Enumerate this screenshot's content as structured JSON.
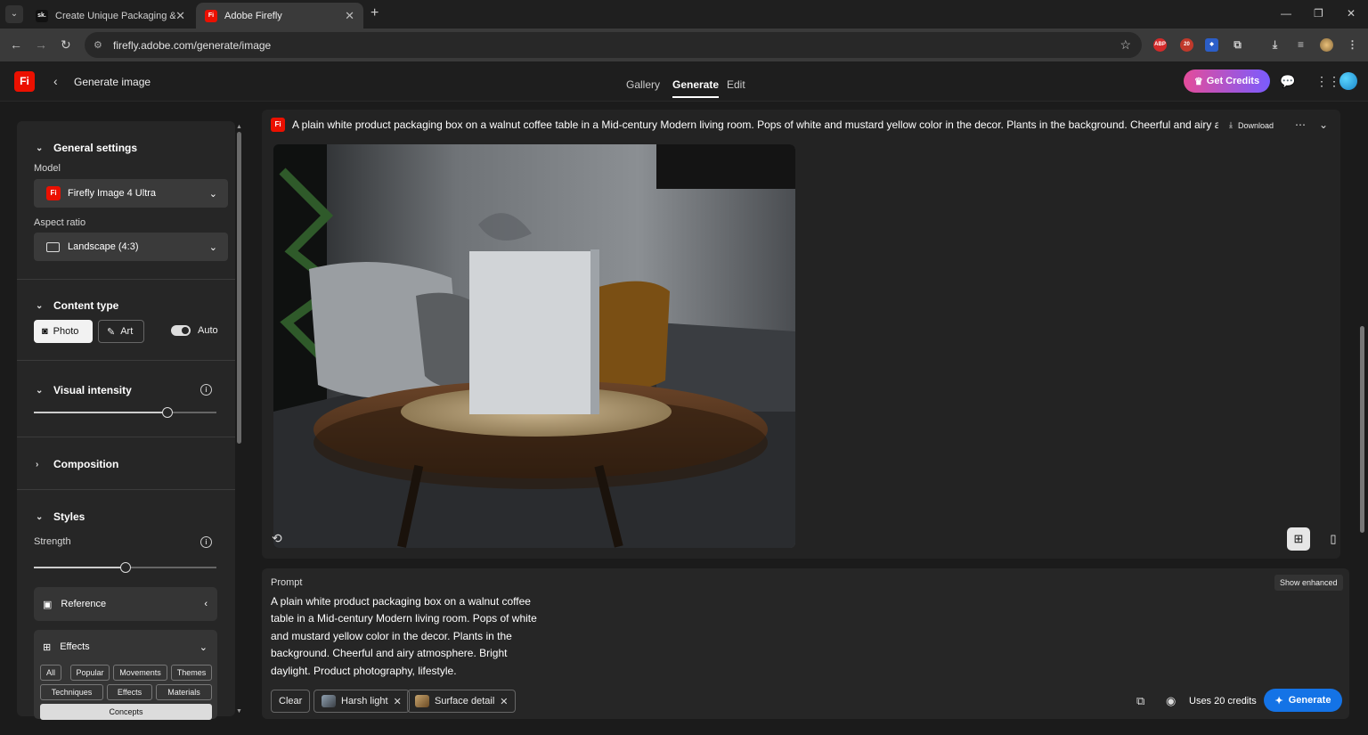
{
  "browser": {
    "tabs": [
      {
        "title": "Create Unique Packaging & Pri",
        "favicon": "sk."
      },
      {
        "title": "Adobe Firefly",
        "favicon": "Fi"
      }
    ],
    "url": "firefly.adobe.com/generate/image",
    "extensions": {
      "abp": "ABP",
      "badge_count": "20"
    }
  },
  "app": {
    "logo": "Fi",
    "title": "Generate image",
    "tabs": [
      {
        "label": "Gallery"
      },
      {
        "label": "Generate"
      },
      {
        "label": "Edit"
      }
    ],
    "get_credits": "Get Credits"
  },
  "sidebar": {
    "general_settings": "General settings",
    "model_label": "Model",
    "model_value": "Firefly Image 4 Ultra",
    "aspect_label": "Aspect ratio",
    "aspect_value": "Landscape (4:3)",
    "content_type": "Content type",
    "photo": "Photo",
    "art": "Art",
    "auto": "Auto",
    "visual_intensity": "Visual intensity",
    "visual_intensity_value": 0.73,
    "composition": "Composition",
    "styles": "Styles",
    "strength_label": "Strength",
    "strength_value": 0.5,
    "reference": "Reference",
    "effects": "Effects",
    "effect_chips": [
      "All",
      "Popular",
      "Movements",
      "Themes",
      "Techniques",
      "Effects",
      "Materials",
      "Concepts"
    ]
  },
  "result": {
    "prompt": "A plain white product packaging box on a walnut coffee table in a Mid-century Modern living room. Pops of white and mustard yellow color in the decor. Plants in the background. Cheerful and airy atm",
    "download": "Download"
  },
  "prompt_panel": {
    "label": "Prompt",
    "show_enhanced": "Show enhanced",
    "text": "A plain white product packaging box on a walnut coffee table in a Mid-century Modern living room. Pops of white and mustard yellow color in the decor. Plants in the background. Cheerful and airy atmosphere. Bright daylight. Product photography, lifestyle.",
    "clear": "Clear",
    "tags": [
      {
        "label": "Harsh light"
      },
      {
        "label": "Surface detail"
      }
    ],
    "uses_credits": "Uses 20 credits",
    "generate": "Generate"
  },
  "colors": {
    "accent_blue": "#1473e6",
    "adobe_red": "#eb1000"
  }
}
